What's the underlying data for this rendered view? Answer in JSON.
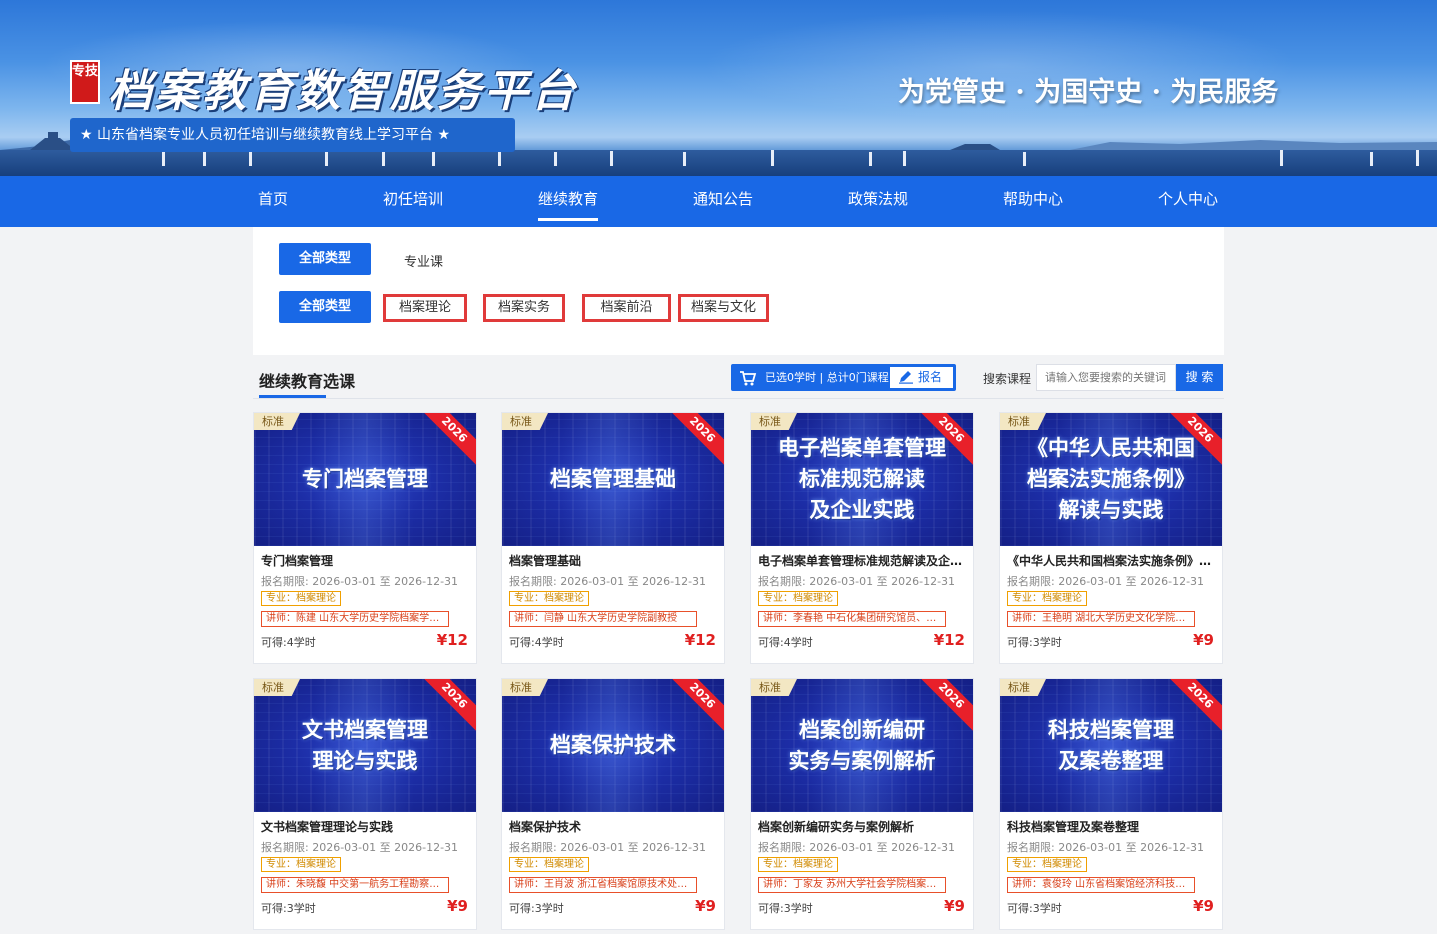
{
  "header": {
    "seal_text": "专技",
    "title": "档案教育数智服务平台",
    "subtitle": "★ 山东省档案专业人员初任培训与继续教育线上学习平台 ★",
    "slogan": "为党管史 · 为国守史 · 为民服务"
  },
  "nav": {
    "items": [
      {
        "label": "首页",
        "active": false
      },
      {
        "label": "初任培训",
        "active": false
      },
      {
        "label": "继续教育",
        "active": true
      },
      {
        "label": "通知公告",
        "active": false
      },
      {
        "label": "政策法规",
        "active": false
      },
      {
        "label": "帮助中心",
        "active": false
      },
      {
        "label": "个人中心",
        "active": false
      }
    ]
  },
  "filters": {
    "row1": {
      "all_label": "全部类型",
      "options": [
        "专业课"
      ]
    },
    "row2": {
      "all_label": "全部类型",
      "options": [
        "档案理论",
        "档案实务",
        "档案前沿",
        "档案与文化"
      ]
    }
  },
  "section": {
    "title": "继续教育选课",
    "cart_text": "已选0学时 | 总计0门课程",
    "enroll_label": "报名",
    "search_label": "搜索课程",
    "search_placeholder": "请输入您要搜索的关键词",
    "search_button": "搜 索"
  },
  "courses": [
    {
      "tag": "标准",
      "year": "2026",
      "thumb_title": "专门档案管理",
      "name": "专门档案管理",
      "date": "报名期限: 2026-03-01 至 2026-12-31",
      "major": "专业：档案理论",
      "teacher": "讲师：陈建 山东大学历史学院档案学系教授",
      "hours": "可得:4学时",
      "price": "¥12"
    },
    {
      "tag": "标准",
      "year": "2026",
      "thumb_title": "档案管理基础",
      "name": "档案管理基础",
      "date": "报名期限: 2026-03-01 至 2026-12-31",
      "major": "专业：档案理论",
      "teacher": "讲师：闫静 山东大学历史学院副教授",
      "hours": "可得:4学时",
      "price": "¥12"
    },
    {
      "tag": "标准",
      "year": "2026",
      "thumb_title": "电子档案单套管理\n标准规范解读\n及企业实践",
      "name": "电子档案单套管理标准规范解读及企业实践",
      "date": "报名期限: 2026-03-01 至 2026-12-31",
      "major": "专业：档案理论",
      "teacher": "讲师：李春艳 中石化集团研究馆员、国家档案局专家",
      "hours": "可得:4学时",
      "price": "¥12"
    },
    {
      "tag": "标准",
      "year": "2026",
      "thumb_title": "《中华人民共和国\n档案法实施条例》\n解读与实践",
      "name": "《中华人民共和国档案法实施条例》解读与实践",
      "date": "报名期限: 2026-03-01 至 2026-12-31",
      "major": "专业：档案理论",
      "teacher": "讲师：王艳明 湖北大学历史文化学院教授",
      "hours": "可得:3学时",
      "price": "¥9"
    },
    {
      "tag": "标准",
      "year": "2026",
      "thumb_title": "文书档案管理\n理论与实践",
      "name": "文书档案管理理论与实践",
      "date": "报名期限: 2026-03-01 至 2026-12-31",
      "major": "专业：档案理论",
      "teacher": "讲师：朱晓馥 中交第一航务工程勘察设计院",
      "hours": "可得:3学时",
      "price": "¥9"
    },
    {
      "tag": "标准",
      "year": "2026",
      "thumb_title": "档案保护技术",
      "name": "档案保护技术",
      "date": "报名期限: 2026-03-01 至 2026-12-31",
      "major": "专业：档案理论",
      "teacher": "讲师：王肖波 浙江省档案馆原技术处处长",
      "hours": "可得:3学时",
      "price": "¥9"
    },
    {
      "tag": "标准",
      "year": "2026",
      "thumb_title": "档案创新编研\n实务与案例解析",
      "name": "档案创新编研实务与案例解析",
      "date": "报名期限: 2026-03-01 至 2026-12-31",
      "major": "专业：档案理论",
      "teacher": "讲师：丁家友 苏州大学社会学院档案与电子政务系",
      "hours": "可得:3学时",
      "price": "¥9"
    },
    {
      "tag": "标准",
      "year": "2026",
      "thumb_title": "科技档案管理\n及案卷整理",
      "name": "科技档案管理及案卷整理",
      "date": "报名期限: 2026-03-01 至 2026-12-31",
      "major": "专业：档案理论",
      "teacher": "讲师：袁俊玲 山东省档案馆经济科技档案处",
      "hours": "可得:3学时",
      "price": "¥9"
    }
  ],
  "colors": {
    "primary": "#1968e6",
    "price": "#e02020",
    "ribbon": "#e8202a",
    "filter_highlight": "#e03a3a"
  }
}
